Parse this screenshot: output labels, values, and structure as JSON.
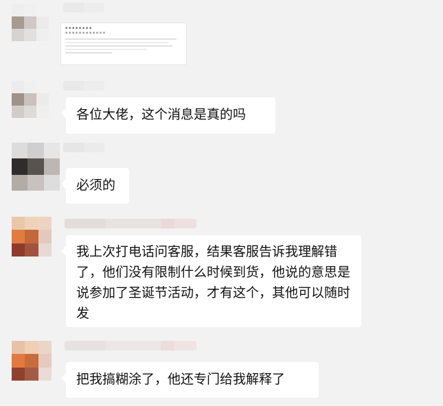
{
  "messages": [
    {
      "type": "image-card"
    },
    {
      "text": "各位大佬，这个消息是真的吗"
    },
    {
      "text": "必须的"
    },
    {
      "text": "我上次打电话问客服，结果客服告诉我理解错了，他们没有限制什么时候到货，他说的意思是说参加了圣诞节活动，才有这个，其他可以随时发"
    },
    {
      "text": "把我搞糊涂了，他还专门给我解释了"
    }
  ],
  "colors": {
    "background": "#f2f2f2",
    "bubble": "#ffffff"
  }
}
